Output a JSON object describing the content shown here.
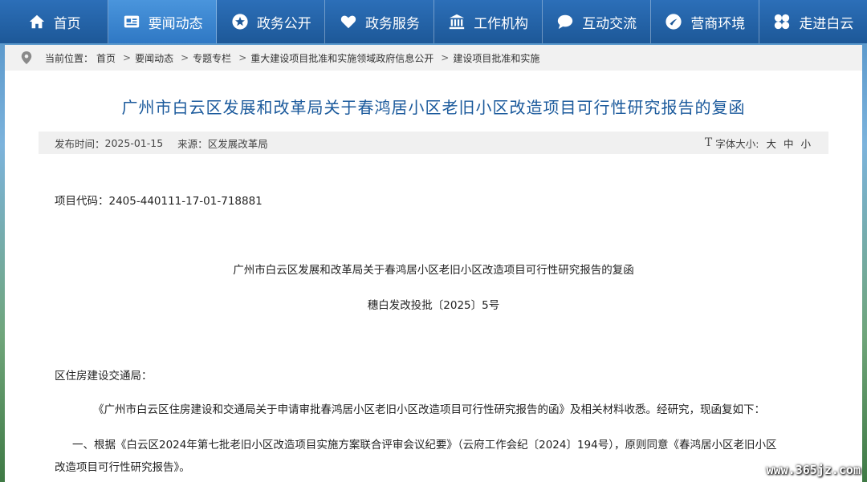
{
  "nav": [
    {
      "label": "首页",
      "icon": "home-icon"
    },
    {
      "label": "要闻动态",
      "icon": "news-icon"
    },
    {
      "label": "政务公开",
      "icon": "star-icon"
    },
    {
      "label": "政务服务",
      "icon": "heart-icon"
    },
    {
      "label": "工作机构",
      "icon": "building-icon"
    },
    {
      "label": "互动交流",
      "icon": "chat-icon"
    },
    {
      "label": "营商环境",
      "icon": "business-icon"
    },
    {
      "label": "走进白云",
      "icon": "clover-icon"
    }
  ],
  "breadcrumb": {
    "prefix": "当前位置：",
    "items": [
      "首页",
      "要闻动态",
      "专题专栏",
      "重大建设项目批准和实施领域政府信息公开",
      "建设项目批准和实施"
    ],
    "separator": ">"
  },
  "article": {
    "title": "广州市白云区发展和改革局关于春鸿居小区老旧小区改造项目可行性研究报告的复函",
    "publish_label": "发布时间：",
    "publish_date": "2025-01-15",
    "source_label": "来源：",
    "source": "区发展改革局",
    "fontsize_icon": "T",
    "fontsize_label": "字体大小:",
    "fontsize_options": [
      "大",
      "中",
      "小"
    ],
    "project_code": "项目代码：2405-440111-17-01-718881",
    "doc_title": "广州市白云区发展和改革局关于春鸿居小区老旧小区改造项目可行性研究报告的复函",
    "doc_number": "穗白发改投批〔2025〕5号",
    "addressee": "区住房建设交通局：",
    "paragraph1": "《广州市白云区住房建设和交通局关于申请审批春鸿居小区老旧小区改造项目可行性研究报告的函》及相关材料收悉。经研究，现函复如下：",
    "paragraph2_line1": "一、根据《白云区2024年第七批老旧小区改造项目实施方案联合评审会议纪要》（云府工作会纪〔2024〕194号），原则同意《春鸿居小区老旧小区",
    "paragraph2_line2": "改造项目可行性研究报告》。"
  },
  "watermark": "www.365jz.com",
  "colors": {
    "nav_bg": "#1f5ea6",
    "nav_active": "#3d88d2",
    "title": "#1b5a9c"
  }
}
